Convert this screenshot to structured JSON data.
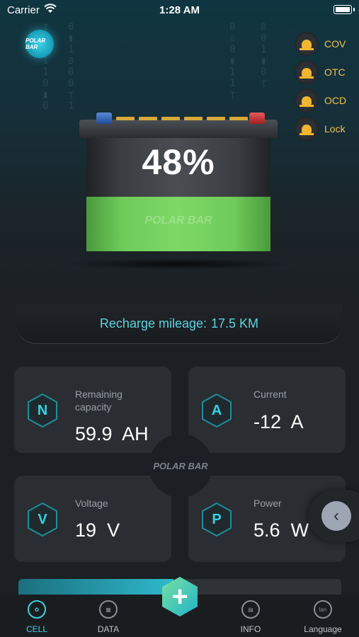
{
  "status_bar": {
    "carrier": "Carrier",
    "time": "1:28 AM"
  },
  "brand": {
    "logo_text": "POLAR BAR",
    "watermark": "POLAR BAR"
  },
  "alerts": [
    {
      "label": "COV"
    },
    {
      "label": "OTC"
    },
    {
      "label": "OCD"
    },
    {
      "label": "Lock"
    }
  ],
  "battery": {
    "percent_text": "48%",
    "level": 0.48
  },
  "mileage": {
    "label": "Recharge mileage:",
    "value": "17.5 KM"
  },
  "metrics": [
    {
      "icon": "N",
      "label": "Remaining capacity",
      "value": "59.9",
      "unit": "AH"
    },
    {
      "icon": "A",
      "label": "Current",
      "value": "-12",
      "unit": "A"
    },
    {
      "icon": "V",
      "label": "Voltage",
      "value": "19",
      "unit": "V"
    },
    {
      "icon": "P",
      "label": "Power",
      "value": "5.6",
      "unit": "W"
    }
  ],
  "progress": {
    "level": 0.48
  },
  "tabs": [
    {
      "label": "CELL",
      "active": true
    },
    {
      "label": "DATA",
      "active": false
    },
    {
      "label": "INFO",
      "active": false
    },
    {
      "label": "Language",
      "icon_text": "lan",
      "active": false
    }
  ],
  "colors": {
    "accent": "#3fd0e0",
    "alert": "#f2b531",
    "battery_green": "#7ed866"
  }
}
